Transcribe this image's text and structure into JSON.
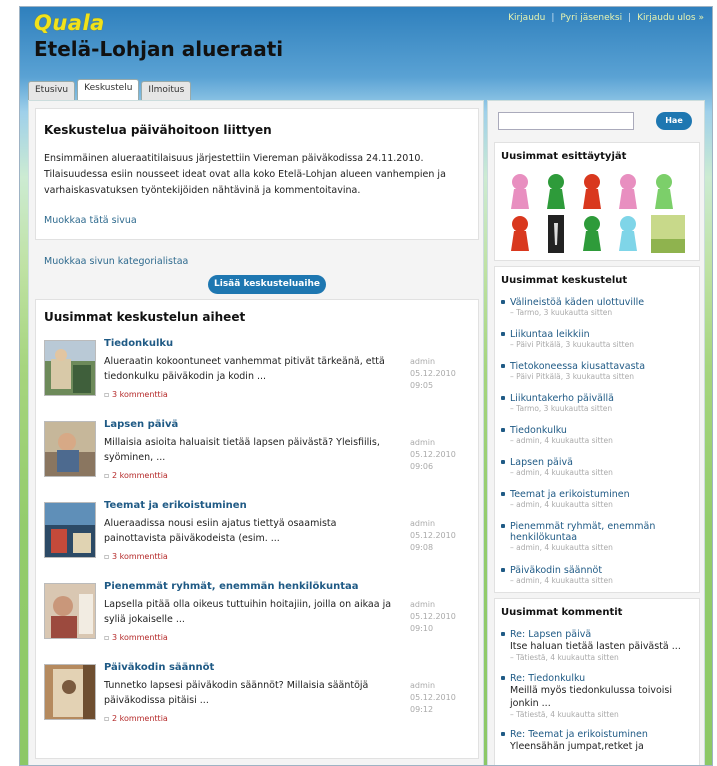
{
  "brand": {
    "logo": "Quala",
    "site_title": "Etelä-Lohjan alueraati"
  },
  "top_links": [
    "Kirjaudu",
    "Pyri jäseneksi",
    "Kirjaudu ulos »"
  ],
  "tabs": [
    "Etusivu",
    "Keskustelu",
    "Ilmoitus"
  ],
  "page": {
    "title": "Keskustelua päivähoitoon liittyen",
    "intro": "Ensimmäinen alueraatitilaisuus järjestettiin Viereman päiväkodissa 24.11.2010. Tilaisuudessa esiin nousseet ideat ovat alla koko Etelä-Lohjan alueen vanhempien ja varhaiskasvatuksen työntekijöiden nähtävinä ja kommentoitavina.",
    "edit_link": "Muokkaa tätä sivua",
    "category_link": "Muokkaa sivun kategorialistaa",
    "add_button": "Lisää keskusteluaihe"
  },
  "topics": {
    "title": "Uusimmat keskustelun aiheet",
    "items": [
      {
        "title": "Tiedonkulku",
        "text": "Alueraatin kokoontuneet vanhemmat pitivät tärkeänä, että tiedonkulku päiväkodin ja kodin ...",
        "comments": "3 kommenttia",
        "author": "admin",
        "date": "05.12.2010",
        "time": "09:05"
      },
      {
        "title": "Lapsen päivä",
        "text": "Millaisia asioita haluaisit tietää lapsen päivästä? Yleisfiilis, syöminen, ...",
        "comments": "2 kommenttia",
        "author": "admin",
        "date": "05.12.2010",
        "time": "09:06"
      },
      {
        "title": "Teemat ja erikoistuminen",
        "text": "Alueraadissa nousi esiin ajatus tiettyä osaamista painottavista päiväkodeista (esim. ...",
        "comments": "3 kommenttia",
        "author": "admin",
        "date": "05.12.2010",
        "time": "09:08"
      },
      {
        "title": "Pienemmät ryhmät, enemmän henkilökuntaa",
        "text": "Lapsella pitää olla oikeus tuttuihin hoitajiin, joilla on aikaa ja syliä jokaiselle ...",
        "comments": "3 kommenttia",
        "author": "admin",
        "date": "05.12.2010",
        "time": "09:10"
      },
      {
        "title": "Päiväkodin säännöt",
        "text": "Tunnetko lapsesi päiväkodin säännöt? Millaisia sääntöjä päiväkodissa pitäisi ...",
        "comments": "2 kommenttia",
        "author": "admin",
        "date": "05.12.2010",
        "time": "09:12"
      }
    ]
  },
  "sidebar": {
    "search_button": "Hae",
    "profiles_title": "Uusimmat esittäytyjät",
    "avatar_colors": [
      "#e88fc0",
      "#2e9b3a",
      "#d9381e",
      "#e88fc0",
      "#7ccf6a",
      "#d9381e",
      "#222222",
      "#2e9b3a",
      "#7fd5e8",
      "#c8d98a"
    ],
    "discussions_title": "Uusimmat keskustelut",
    "discussions": [
      {
        "title": "Välineistöä käden ulottuville",
        "sub": "– Tarmo, 3 kuukautta sitten"
      },
      {
        "title": "Liikuntaa leikkiin",
        "sub": "– Päivi Pitkälä, 3 kuukautta sitten"
      },
      {
        "title": "Tietokoneessa kiusattavasta",
        "sub": "– Päivi Pitkälä, 3 kuukautta sitten"
      },
      {
        "title": "Liikuntakerho päivällä",
        "sub": "– Tarmo, 3 kuukautta sitten"
      },
      {
        "title": "Tiedonkulku",
        "sub": "– admin, 4 kuukautta sitten"
      },
      {
        "title": "Lapsen päivä",
        "sub": "– admin, 4 kuukautta sitten"
      },
      {
        "title": "Teemat ja erikoistuminen",
        "sub": "– admin, 4 kuukautta sitten"
      },
      {
        "title": "Pienemmät ryhmät, enemmän henkilökuntaa",
        "sub": "– admin, 4 kuukautta sitten"
      },
      {
        "title": "Päiväkodin säännöt",
        "sub": "– admin, 4 kuukautta sitten"
      }
    ],
    "comments_title": "Uusimmat kommentit",
    "comments": [
      {
        "title": "Re: Lapsen päivä",
        "body": "Itse haluan tietää lasten päivästä ...",
        "sub": "– Tätiestä, 4 kuukautta sitten"
      },
      {
        "title": "Re: Tiedonkulku",
        "body": "Meillä myös tiedonkulussa toivoisi jonkin ...",
        "sub": "– Tätiestä, 4 kuukautta sitten"
      },
      {
        "title": "Re: Teemat ja erikoistuminen",
        "body": "Yleensähän jumpat,retket ja",
        "sub": ""
      }
    ]
  }
}
